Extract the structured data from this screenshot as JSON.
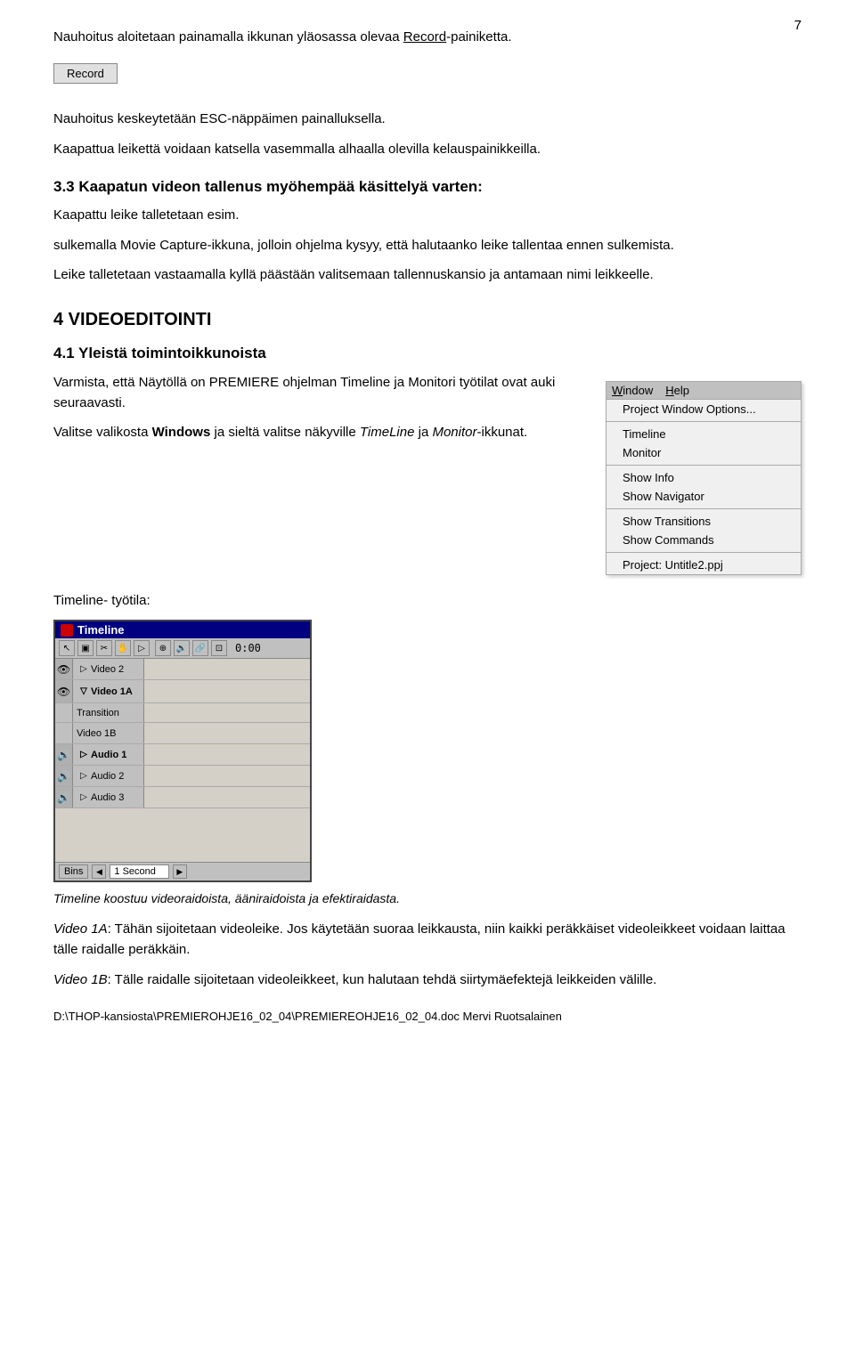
{
  "page": {
    "number": "7",
    "footer_path": "D:\\THOP-kansiosta\\PREMIEROHJE16_02_04\\PREMIEREOHJE16_02_04.doc Mervi Ruotsalainen"
  },
  "paragraphs": {
    "intro1": "Nauhoitus aloitetaan painamalla ikkunan yläosassa olevaa ",
    "intro1_link": "Record",
    "intro1_end": "-painiketta.",
    "record_btn": "Record",
    "intro2": "Nauhoitus keskeytetään ESC-näppäimen painalluksella.",
    "intro3": "Kaapattua leikettä voidaan katsella vasemmalla alhaalla olevilla kelauspainikkeilla.",
    "section33": "3.3 Kaapatun videon tallenus myöhempää käsittelyä varten:",
    "section33_body": "Kaapattu leike talletetaan esim.",
    "section33_body2": "sulkemalla Movie Capture-ikkuna, jolloin ohjelma kysyy, että halutaanko leike tallentaa ennen sulkemista.",
    "section33_body3": "Leike talletetaan vastaamalla kyllä päästään valitsemaan tallennuskansio ja antamaan nimi leikkeelle.",
    "chapter4": "4 VIDEOEDITOINT",
    "chapter4_rest": "I",
    "section41": "4.1 Yleistä toimintoikkunoista",
    "body41_1": "Varmista, että Näytöllä on PREMIERE ohjelman Timeline ja Monitori työtilat ovat auki seuraavasti.",
    "body41_2_pre": "Valitse valikosta ",
    "body41_2_bold": "Windows",
    "body41_2_mid": " ja sieltä valitse  näkyville ",
    "body41_2_italic": "TimeLine",
    "body41_2_end": " ja ",
    "body41_2_italic2": "Monitor",
    "body41_2_end2": "-ikkunat.",
    "timeline_label": "Timeline- työtila:",
    "timeline_caption": "Timeline koostuu videoraidoista, ääniraidoista ja efektiraidasta.",
    "video1a_label": "Video 1A",
    "video1a_text": ":  Tähän sijoitetaan videoleike.  Jos käytetään suoraa leikkausta, niin kaikki peräkkäiset videoleikkeet voidaan laittaa tälle raidalle peräkkäin.",
    "video1b_label": "Video 1B",
    "video1b_text": ":  Tälle raidalle sijoitetaan videoleikkeet, kun halutaan tehdä siirtymäefektejä leikkeiden välille."
  },
  "window_menu": {
    "title_window": "Window",
    "title_help": "Help",
    "items": [
      {
        "label": "Project Window Options...",
        "separator_after": true
      },
      {
        "label": "Timeline",
        "separator_after": false
      },
      {
        "label": "Monitor",
        "separator_after": true
      },
      {
        "label": "Show Info",
        "separator_after": false
      },
      {
        "label": "Show Navigator",
        "separator_after": true
      },
      {
        "label": "Show Transitions",
        "separator_after": false
      },
      {
        "label": "Show Commands",
        "separator_after": true
      },
      {
        "label": "Project: Untitle2.ppj",
        "separator_after": false
      }
    ]
  },
  "timeline": {
    "title": "Timeline",
    "timecode": "0:00",
    "tracks": [
      {
        "type": "video",
        "label": "Video 2",
        "bold": false,
        "icon": "eye"
      },
      {
        "type": "video",
        "label": "Video 1A",
        "bold": true,
        "icon": "eye",
        "expanded": true
      },
      {
        "type": "transition",
        "label": "Transition"
      },
      {
        "type": "video",
        "label": "Video 1B",
        "bold": false,
        "icon": null
      },
      {
        "type": "audio",
        "label": "Audio 1",
        "bold": true,
        "icon": "eye"
      },
      {
        "type": "audio",
        "label": "Audio 2",
        "bold": false,
        "icon": "eye"
      },
      {
        "type": "audio",
        "label": "Audio 3",
        "bold": false,
        "icon": "eye"
      }
    ],
    "footer": {
      "bins_label": "Bins",
      "duration_label": "1 Second"
    }
  }
}
